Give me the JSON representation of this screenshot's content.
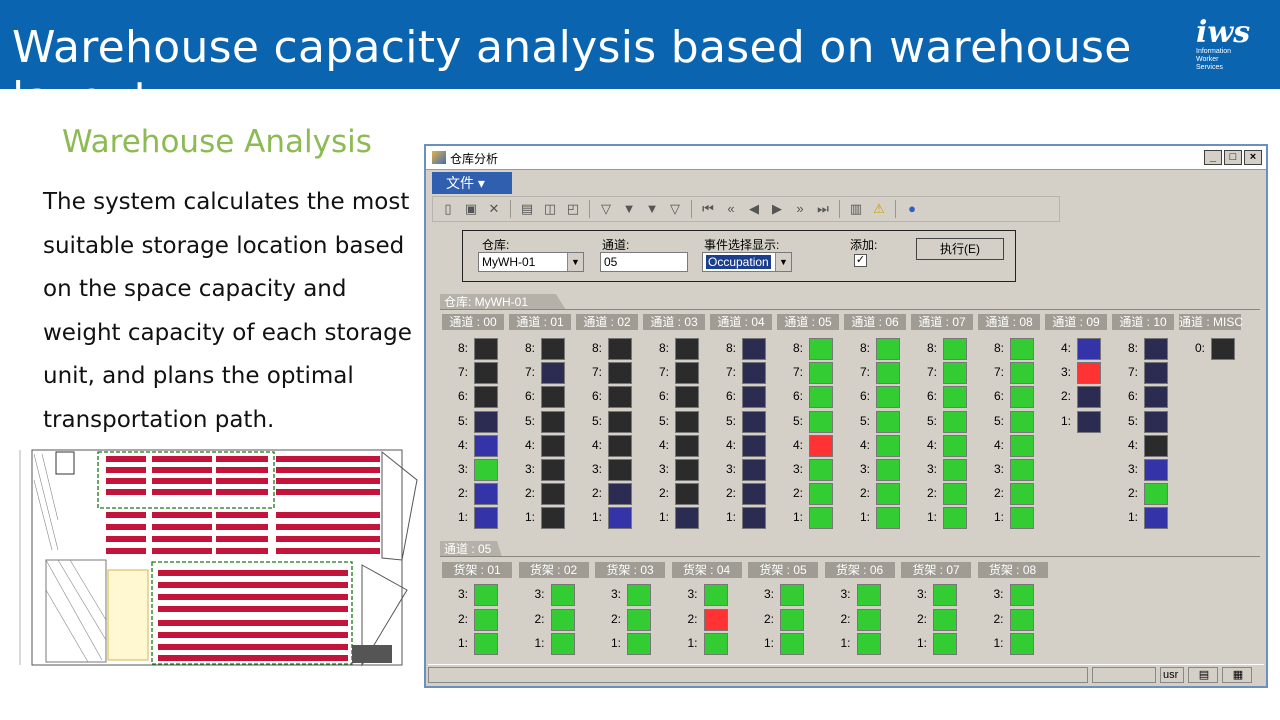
{
  "header": {
    "title": "Warehouse capacity analysis based on warehouse layout",
    "logo_text": "iws",
    "logo_sub": [
      "Information",
      "Worker",
      "Services"
    ]
  },
  "left": {
    "subtitle": "Warehouse Analysis",
    "body": " The system calculates the most suitable storage location based on the space capacity and weight capacity of each storage unit, and plans the optimal transportation path."
  },
  "window": {
    "title": "仓库分析",
    "menu_label": "文件 ▾",
    "filter": {
      "warehouse_label": "仓库:",
      "warehouse_value": "MyWH-01",
      "aisle_label": "通道:",
      "aisle_value": "05",
      "event_label": "事件选择显示:",
      "event_value": "Occupation",
      "add_label": "添加:",
      "add_checked": "✓",
      "exec_label": "执行(E)"
    },
    "tab1_label": "仓库: MyWH-01",
    "tab2_label": "通道 : 05",
    "status_user": "usr"
  },
  "colors": {
    "black": "#2b2b2b",
    "navy": "#2c2c52",
    "blue": "#3434a8",
    "green": "#33cc33",
    "red": "#ff3333"
  },
  "aisles": [
    {
      "label": "通道 : 00",
      "cells": [
        [
          "8:",
          "black"
        ],
        [
          "7:",
          "black"
        ],
        [
          "6:",
          "black"
        ],
        [
          "5:",
          "navy"
        ],
        [
          "4:",
          "blue"
        ],
        [
          "3:",
          "green"
        ],
        [
          "2:",
          "blue"
        ],
        [
          "1:",
          "blue"
        ]
      ]
    },
    {
      "label": "通道 : 01",
      "cells": [
        [
          "8:",
          "black"
        ],
        [
          "7:",
          "navy"
        ],
        [
          "6:",
          "black"
        ],
        [
          "5:",
          "black"
        ],
        [
          "4:",
          "black"
        ],
        [
          "3:",
          "black"
        ],
        [
          "2:",
          "black"
        ],
        [
          "1:",
          "black"
        ]
      ]
    },
    {
      "label": "通道 : 02",
      "cells": [
        [
          "8:",
          "black"
        ],
        [
          "7:",
          "black"
        ],
        [
          "6:",
          "black"
        ],
        [
          "5:",
          "black"
        ],
        [
          "4:",
          "black"
        ],
        [
          "3:",
          "black"
        ],
        [
          "2:",
          "navy"
        ],
        [
          "1:",
          "blue"
        ]
      ]
    },
    {
      "label": "通道 : 03",
      "cells": [
        [
          "8:",
          "black"
        ],
        [
          "7:",
          "black"
        ],
        [
          "6:",
          "black"
        ],
        [
          "5:",
          "black"
        ],
        [
          "4:",
          "black"
        ],
        [
          "3:",
          "black"
        ],
        [
          "2:",
          "black"
        ],
        [
          "1:",
          "navy"
        ]
      ]
    },
    {
      "label": "通道 : 04",
      "cells": [
        [
          "8:",
          "navy"
        ],
        [
          "7:",
          "navy"
        ],
        [
          "6:",
          "navy"
        ],
        [
          "5:",
          "navy"
        ],
        [
          "4:",
          "navy"
        ],
        [
          "3:",
          "navy"
        ],
        [
          "2:",
          "navy"
        ],
        [
          "1:",
          "navy"
        ]
      ]
    },
    {
      "label": "通道 : 05",
      "cells": [
        [
          "8:",
          "green"
        ],
        [
          "7:",
          "green"
        ],
        [
          "6:",
          "green"
        ],
        [
          "5:",
          "green"
        ],
        [
          "4:",
          "red"
        ],
        [
          "3:",
          "green"
        ],
        [
          "2:",
          "green"
        ],
        [
          "1:",
          "green"
        ]
      ]
    },
    {
      "label": "通道 : 06",
      "cells": [
        [
          "8:",
          "green"
        ],
        [
          "7:",
          "green"
        ],
        [
          "6:",
          "green"
        ],
        [
          "5:",
          "green"
        ],
        [
          "4:",
          "green"
        ],
        [
          "3:",
          "green"
        ],
        [
          "2:",
          "green"
        ],
        [
          "1:",
          "green"
        ]
      ]
    },
    {
      "label": "通道 : 07",
      "cells": [
        [
          "8:",
          "green"
        ],
        [
          "7:",
          "green"
        ],
        [
          "6:",
          "green"
        ],
        [
          "5:",
          "green"
        ],
        [
          "4:",
          "green"
        ],
        [
          "3:",
          "green"
        ],
        [
          "2:",
          "green"
        ],
        [
          "1:",
          "green"
        ]
      ]
    },
    {
      "label": "通道 : 08",
      "cells": [
        [
          "8:",
          "green"
        ],
        [
          "7:",
          "green"
        ],
        [
          "6:",
          "green"
        ],
        [
          "5:",
          "green"
        ],
        [
          "4:",
          "green"
        ],
        [
          "3:",
          "green"
        ],
        [
          "2:",
          "green"
        ],
        [
          "1:",
          "green"
        ]
      ]
    },
    {
      "label": "通道 : 09",
      "cells": [
        [
          "4:",
          "blue"
        ],
        [
          "3:",
          "red"
        ],
        [
          "2:",
          "navy"
        ],
        [
          "1:",
          "navy"
        ]
      ]
    },
    {
      "label": "通道 : 10",
      "cells": [
        [
          "8:",
          "navy"
        ],
        [
          "7:",
          "navy"
        ],
        [
          "6:",
          "navy"
        ],
        [
          "5:",
          "navy"
        ],
        [
          "4:",
          "black"
        ],
        [
          "3:",
          "blue"
        ],
        [
          "2:",
          "green"
        ],
        [
          "1:",
          "blue"
        ]
      ]
    },
    {
      "label": "通道 : MISC",
      "cells": [
        [
          "0:",
          "black"
        ]
      ]
    }
  ],
  "racks": [
    {
      "label": "货架 : 01",
      "cells": [
        [
          "3:",
          "green"
        ],
        [
          "2:",
          "green"
        ],
        [
          "1:",
          "green"
        ]
      ]
    },
    {
      "label": "货架 : 02",
      "cells": [
        [
          "3:",
          "green"
        ],
        [
          "2:",
          "green"
        ],
        [
          "1:",
          "green"
        ]
      ]
    },
    {
      "label": "货架 : 03",
      "cells": [
        [
          "3:",
          "green"
        ],
        [
          "2:",
          "green"
        ],
        [
          "1:",
          "green"
        ]
      ]
    },
    {
      "label": "货架 : 04",
      "cells": [
        [
          "3:",
          "green"
        ],
        [
          "2:",
          "red"
        ],
        [
          "1:",
          "green"
        ]
      ]
    },
    {
      "label": "货架 : 05",
      "cells": [
        [
          "3:",
          "green"
        ],
        [
          "2:",
          "green"
        ],
        [
          "1:",
          "green"
        ]
      ]
    },
    {
      "label": "货架 : 06",
      "cells": [
        [
          "3:",
          "green"
        ],
        [
          "2:",
          "green"
        ],
        [
          "1:",
          "green"
        ]
      ]
    },
    {
      "label": "货架 : 07",
      "cells": [
        [
          "3:",
          "green"
        ],
        [
          "2:",
          "green"
        ],
        [
          "1:",
          "green"
        ]
      ]
    },
    {
      "label": "货架 : 08",
      "cells": [
        [
          "3:",
          "green"
        ],
        [
          "2:",
          "green"
        ],
        [
          "1:",
          "green"
        ]
      ]
    }
  ]
}
